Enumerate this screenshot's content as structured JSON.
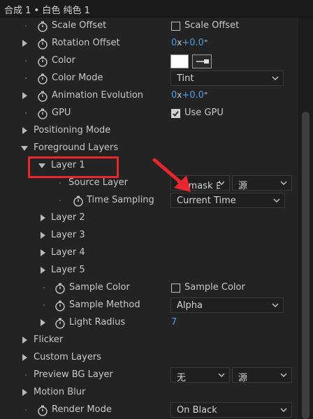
{
  "window": {
    "title": "合成 1 • 白色 纯色 1"
  },
  "rows": {
    "scale_offset": {
      "label": "Scale Offset",
      "checkbox_label": "Scale Offset",
      "checked": false
    },
    "rotation_offset": {
      "label": "Rotation Offset",
      "rev": "0",
      "x": "x",
      "deg": "+0.0",
      "deg_sym": "°"
    },
    "color": {
      "label": "Color",
      "swatch": "#ffffff"
    },
    "color_mode": {
      "label": "Color Mode",
      "value": "Tint"
    },
    "animation_evolution": {
      "label": "Animation Evolution",
      "rev": "0",
      "x": "x",
      "deg": "+0.0",
      "deg_sym": "°"
    },
    "gpu": {
      "label": "GPU",
      "checkbox_label": "Use GPU",
      "checked": true
    },
    "positioning_mode": {
      "label": "Positioning Mode"
    },
    "foreground_layers": {
      "label": "Foreground Layers"
    },
    "layer1": {
      "label": "Layer 1"
    },
    "source_layer": {
      "label": "Source Layer",
      "value": "2. mask 白",
      "source_value": "源"
    },
    "time_sampling": {
      "label": "Time Sampling",
      "value": "Current Time"
    },
    "layer2": {
      "label": "Layer 2"
    },
    "layer3": {
      "label": "Layer 3"
    },
    "layer4": {
      "label": "Layer 4"
    },
    "layer5": {
      "label": "Layer 5"
    },
    "sample_color": {
      "label": "Sample Color",
      "checkbox_label": "Sample Color",
      "checked": false
    },
    "sample_method": {
      "label": "Sample Method",
      "value": "Alpha"
    },
    "light_radius": {
      "label": "Light Radius",
      "value": "7"
    },
    "flicker": {
      "label": "Flicker"
    },
    "custom_layers": {
      "label": "Custom Layers"
    },
    "preview_bg_layer": {
      "label": "Preview BG Layer",
      "value": "无",
      "source_value": "源"
    },
    "motion_blur": {
      "label": "Motion Blur"
    },
    "render_mode": {
      "label": "Render Mode",
      "value": "On Black"
    }
  },
  "colors": {
    "accent": "#4a9fe6",
    "highlight": "#e8262b",
    "background": "#232323"
  }
}
